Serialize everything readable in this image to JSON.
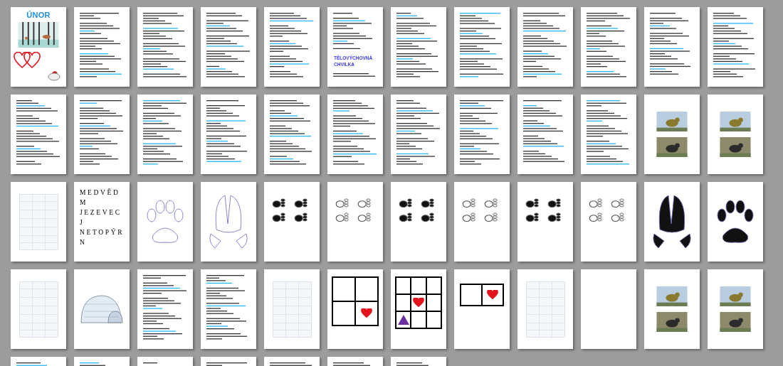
{
  "pages": [
    {
      "kind": "cover",
      "title": "ÚNOR"
    },
    {
      "kind": "text"
    },
    {
      "kind": "text"
    },
    {
      "kind": "text"
    },
    {
      "kind": "text"
    },
    {
      "kind": "heading",
      "heading": "TĚLOVÝCHOVNÁ CHVILKA"
    },
    {
      "kind": "text"
    },
    {
      "kind": "text"
    },
    {
      "kind": "text"
    },
    {
      "kind": "text"
    },
    {
      "kind": "text"
    },
    {
      "kind": "text"
    },
    {
      "kind": "text"
    },
    {
      "kind": "text"
    },
    {
      "kind": "text"
    },
    {
      "kind": "text"
    },
    {
      "kind": "text"
    },
    {
      "kind": "text"
    },
    {
      "kind": "text"
    },
    {
      "kind": "text"
    },
    {
      "kind": "text"
    },
    {
      "kind": "text"
    },
    {
      "kind": "photos"
    },
    {
      "kind": "photos"
    },
    {
      "kind": "table"
    },
    {
      "kind": "words",
      "words": [
        "MEDVĚD",
        "M",
        "JEZEVEC",
        "J",
        "NETOPÝR",
        "N"
      ]
    },
    {
      "kind": "paw"
    },
    {
      "kind": "hoof"
    },
    {
      "kind": "tracks"
    },
    {
      "kind": "tracks"
    },
    {
      "kind": "tracks"
    },
    {
      "kind": "tracks"
    },
    {
      "kind": "tracks"
    },
    {
      "kind": "tracks"
    },
    {
      "kind": "hoof-filled"
    },
    {
      "kind": "paw-filled"
    },
    {
      "kind": "table"
    },
    {
      "kind": "igloo"
    },
    {
      "kind": "text"
    },
    {
      "kind": "text"
    },
    {
      "kind": "table"
    },
    {
      "kind": "grid-heart"
    },
    {
      "kind": "grid-heart-triangle"
    },
    {
      "kind": "grid-pair"
    },
    {
      "kind": "table"
    },
    {
      "kind": "blank"
    },
    {
      "kind": "photos"
    },
    {
      "kind": "photos"
    },
    {
      "kind": "text"
    },
    {
      "kind": "text"
    },
    {
      "kind": "text"
    },
    {
      "kind": "text"
    },
    {
      "kind": "text"
    },
    {
      "kind": "text"
    },
    {
      "kind": "text"
    }
  ]
}
